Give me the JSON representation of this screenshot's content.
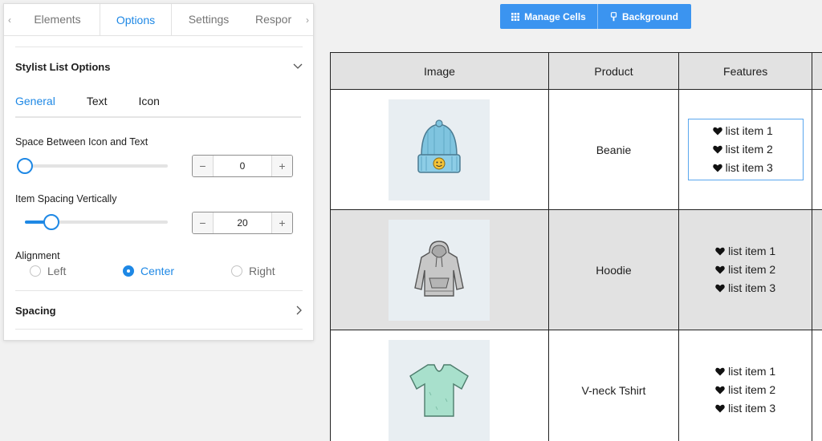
{
  "panel": {
    "tabs": [
      {
        "label": "Elements",
        "active": false
      },
      {
        "label": "Options",
        "active": true
      },
      {
        "label": "Settings",
        "active": false
      },
      {
        "label": "Respor",
        "active": false
      }
    ],
    "section_title": "Stylist List Options",
    "subtabs": [
      {
        "label": "General",
        "active": true
      },
      {
        "label": "Text",
        "active": false
      },
      {
        "label": "Icon",
        "active": false
      }
    ],
    "space_between": {
      "label": "Space Between Icon and Text",
      "value": "0",
      "slider_fraction": 0.0
    },
    "item_spacing": {
      "label": "Item Spacing Vertically",
      "value": "20",
      "slider_fraction": 0.2
    },
    "alignment": {
      "label": "Alignment",
      "options": [
        "Left",
        "Center",
        "Right"
      ],
      "selected": "Center"
    },
    "spacing_section": "Spacing",
    "accent_color": "#1e88e5"
  },
  "toolbar": {
    "manage_cells": "Manage Cells",
    "background": "Background"
  },
  "table": {
    "headers": [
      "Image",
      "Product",
      "Features"
    ],
    "rows": [
      {
        "product": "Beanie",
        "image_icon": "beanie-icon",
        "features": [
          "list item 1",
          "list item 2",
          "list item 3"
        ],
        "selected": true
      },
      {
        "product": "Hoodie",
        "image_icon": "hoodie-icon",
        "features": [
          "list item 1",
          "list item 2",
          "list item 3"
        ],
        "selected": false
      },
      {
        "product": "V-neck Tshirt",
        "image_icon": "tshirt-icon",
        "features": [
          "list item 1",
          "list item 2",
          "list item 3"
        ],
        "selected": false
      }
    ],
    "feature_icon": "heart-icon"
  }
}
